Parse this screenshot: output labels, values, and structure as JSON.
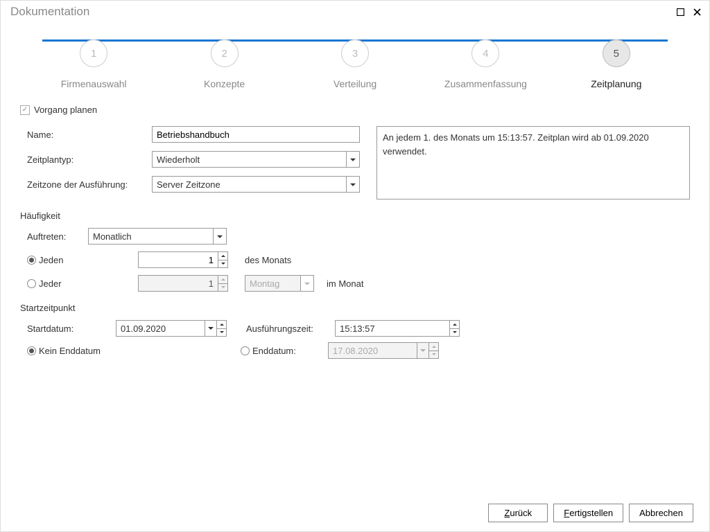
{
  "window": {
    "title": "Dokumentation"
  },
  "wizard": {
    "steps": [
      {
        "num": "1",
        "label": "Firmenauswahl"
      },
      {
        "num": "2",
        "label": "Konzepte"
      },
      {
        "num": "3",
        "label": "Verteilung"
      },
      {
        "num": "4",
        "label": "Zusammenfassung"
      },
      {
        "num": "5",
        "label": "Zeitplanung"
      }
    ]
  },
  "plan": {
    "checkbox": "Vorgang planen"
  },
  "fields": {
    "name_label": "Name:",
    "name_value": "Betriebshandbuch",
    "type_label": "Zeitplantyp:",
    "type_value": "Wiederholt",
    "tz_label": "Zeitzone der Ausführung:",
    "tz_value": "Server Zeitzone"
  },
  "summary": "An jedem 1. des Monats um 15:13:57. Zeitplan wird ab 01.09.2020 verwendet.",
  "freq": {
    "header": "Häufigkeit",
    "occur_label": "Auftreten:",
    "occur_value": "Monatlich",
    "mode_each": "Jeden",
    "each_value": "1",
    "each_suffix": "des Monats",
    "mode_every": "Jeder",
    "every_value": "1",
    "every_day": "Montag",
    "every_suffix": "im Monat"
  },
  "start": {
    "header": "Startzeitpunkt",
    "date_label": "Startdatum:",
    "date_value": "01.09.2020",
    "exec_label": "Ausführungszeit:",
    "exec_value": "15:13:57",
    "noend_label": "Kein Enddatum",
    "end_label": "Enddatum:",
    "end_value": "17.08.2020"
  },
  "buttons": {
    "back": "Zurück",
    "finish": "Fertigstellen",
    "cancel": "Abbrechen"
  }
}
